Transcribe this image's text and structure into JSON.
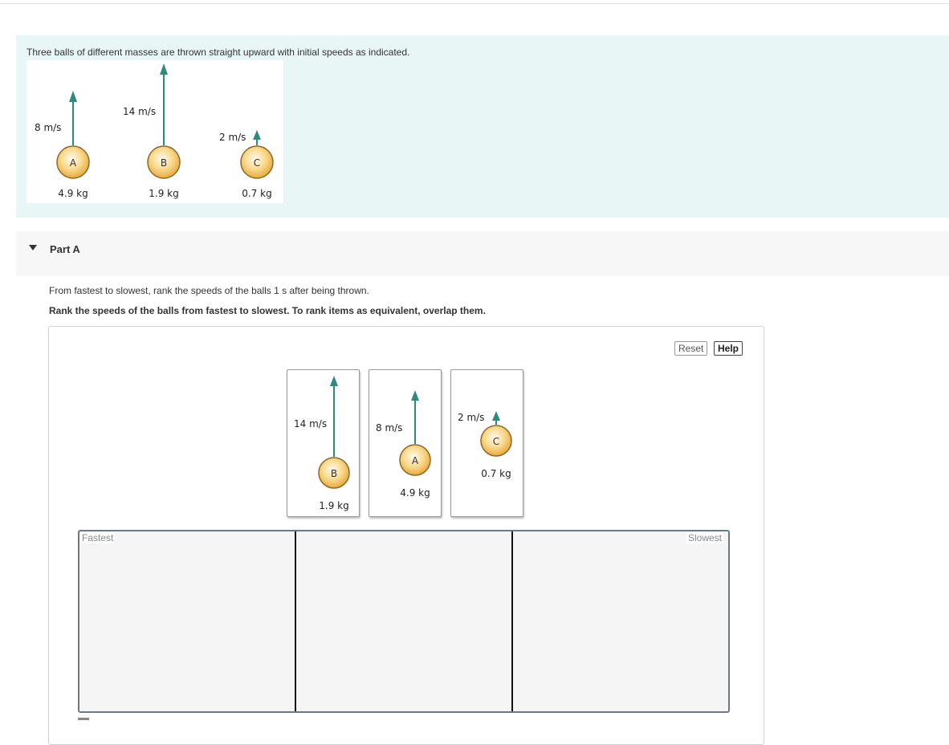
{
  "intro": {
    "text": "Three balls of different masses are thrown straight upward with initial speeds as indicated.",
    "balls": [
      {
        "letter": "A",
        "speed": "8 m/s",
        "mass": "4.9 kg"
      },
      {
        "letter": "B",
        "speed": "14 m/s",
        "mass": "1.9 kg"
      },
      {
        "letter": "C",
        "speed": "2 m/s",
        "mass": "0.7 kg"
      }
    ]
  },
  "part": {
    "title": "Part A",
    "question": "From fastest to slowest, rank the speeds of the balls 1 s after being thrown.",
    "instruction": "Rank the speeds of the balls from fastest to slowest. To rank items as equivalent, overlap them."
  },
  "toolbar": {
    "reset_label": "Reset",
    "help_label": "Help"
  },
  "cards": [
    {
      "letter": "B",
      "speed": "14 m/s",
      "mass": "1.9 kg"
    },
    {
      "letter": "A",
      "speed": "8 m/s",
      "mass": "4.9 kg"
    },
    {
      "letter": "C",
      "speed": "2 m/s",
      "mass": "0.7 kg"
    }
  ],
  "bins": {
    "fastest_label": "Fastest",
    "slowest_label": "Slowest"
  },
  "colors": {
    "arrow": "#2e8b7a",
    "ball_fill": "#f7c66b",
    "ball_stroke": "#8a6a2a",
    "intro_bg": "#e8f6f6"
  }
}
